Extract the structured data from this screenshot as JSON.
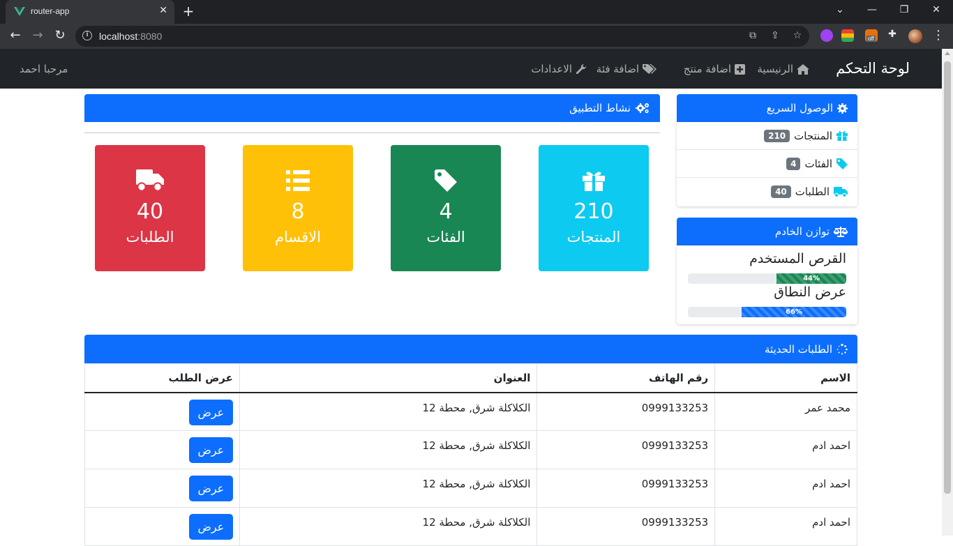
{
  "browser": {
    "tab_title": "router-app",
    "url_host": "localhost",
    "url_port": ":8080",
    "extension_badge": "off"
  },
  "nav": {
    "brand": "لوحة التحكم",
    "links": [
      {
        "label": "الرنيسية",
        "icon": "home-icon"
      },
      {
        "label": "اضافة منتج",
        "icon": "plus-square-icon"
      },
      {
        "label": "اضافة فئة",
        "icon": "tags-icon"
      },
      {
        "label": "الاعدادات",
        "icon": "wrench-icon"
      }
    ],
    "welcome": "مرحبا احمد"
  },
  "quick_access": {
    "title": "الوصول السريع",
    "items": [
      {
        "label": "المنتجات",
        "count": "210",
        "icon": "gift-icon"
      },
      {
        "label": "الفئات",
        "count": "4",
        "icon": "tag-icon"
      },
      {
        "label": "الطلبات",
        "count": "40",
        "icon": "truck-icon"
      }
    ]
  },
  "server_balance": {
    "title": "توازن الخادم",
    "disk": {
      "label": "القرص المستخدم",
      "percent": 44,
      "percent_label": "44%"
    },
    "bandwidth": {
      "label": "عرض النطاق",
      "percent": 66,
      "percent_label": "66%"
    }
  },
  "activity": {
    "title": "نشاط التطبيق",
    "tiles": [
      {
        "label": "المنتجات",
        "value": "210",
        "color": "#0dcaf0",
        "icon": "gift-icon"
      },
      {
        "label": "الفئات",
        "value": "4",
        "color": "#198754",
        "icon": "tag-icon"
      },
      {
        "label": "الاقسام",
        "value": "8",
        "color": "#ffc107",
        "icon": "list-icon"
      },
      {
        "label": "الطلبات",
        "value": "40",
        "color": "#dc3545",
        "icon": "truck-icon"
      }
    ]
  },
  "orders": {
    "title": "الطلبات الحديثة",
    "columns": [
      "الاسم",
      "رقم الهاتف",
      "العنوان",
      "عرض الطلب"
    ],
    "rows": [
      {
        "name": "محمد عمر",
        "phone": "0999133253",
        "address": "الكلاكلة شرق, محطة 12",
        "action": "عرض"
      },
      {
        "name": "احمد ادم",
        "phone": "0999133253",
        "address": "الكلاكلة شرق, محطة 12",
        "action": "عرض"
      },
      {
        "name": "احمد ادم",
        "phone": "0999133253",
        "address": "الكلاكلة شرق, محطة 12",
        "action": "عرض"
      },
      {
        "name": "احمد ادم",
        "phone": "0999133253",
        "address": "الكلاكلة شرق, محطة 12",
        "action": "عرض"
      }
    ]
  },
  "colors": {
    "primary": "#0d6efd",
    "navbar": "#212529",
    "success": "#198754"
  }
}
